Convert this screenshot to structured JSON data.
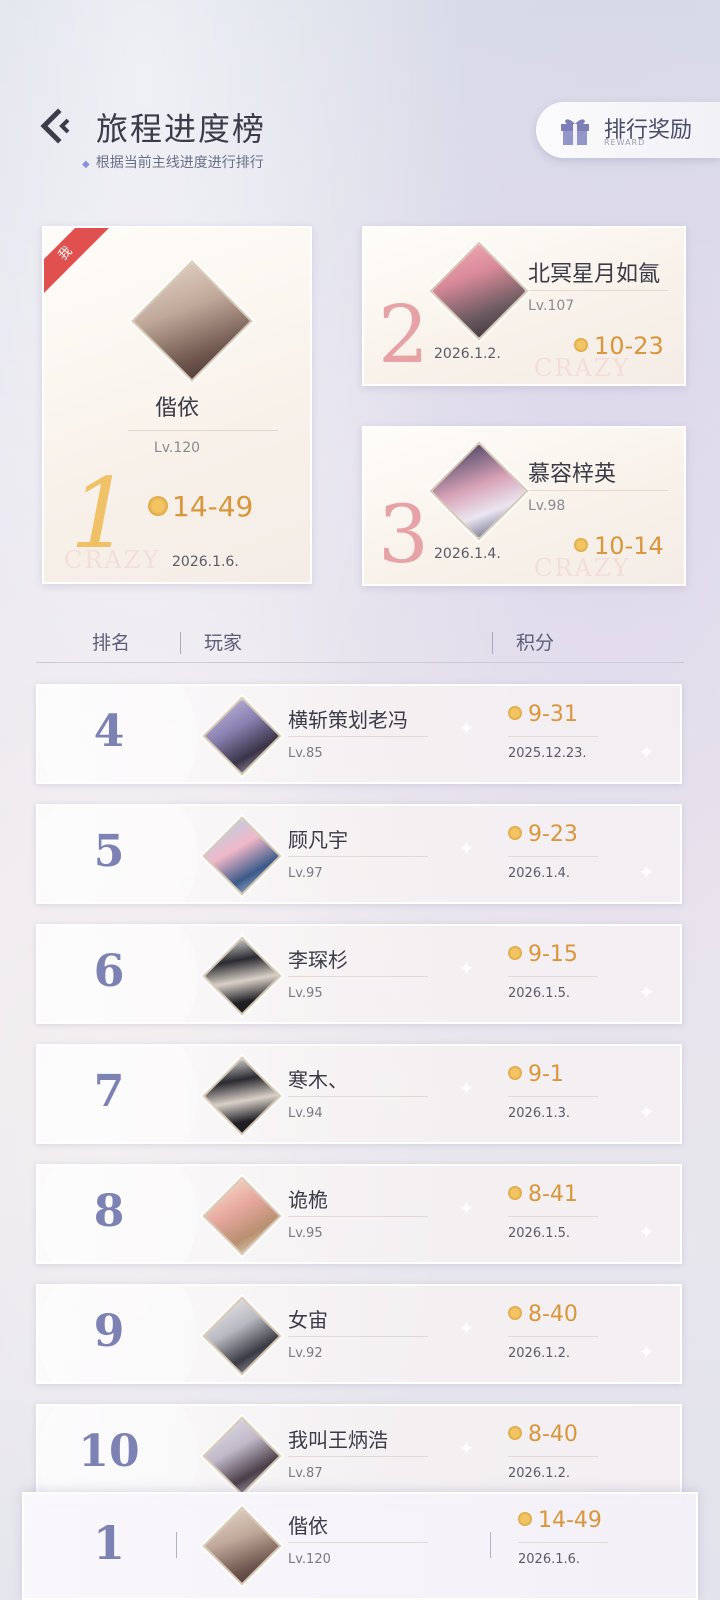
{
  "header": {
    "title": "旅程进度榜",
    "subtitle": "根据当前主线进度进行排行",
    "reward_label": "排行奖励",
    "reward_sub": "REWARD"
  },
  "top3": [
    {
      "rank": "1",
      "name": "偕依",
      "level": "Lv.120",
      "score": "14-49",
      "date": "2026.1.6.",
      "me_tag": "我",
      "avatar": "silver-hair-girl-avatar"
    },
    {
      "rank": "2",
      "name": "北冥星月如氤",
      "level": "Lv.107",
      "score": "10-23",
      "date": "2026.1.2.",
      "avatar": "pink-hair-girl-avatar"
    },
    {
      "rank": "3",
      "name": "慕容梓英",
      "level": "Lv.98",
      "score": "10-14",
      "date": "2026.1.4.",
      "avatar": "pink-hair-night-avatar"
    }
  ],
  "watermark": "CRAZY",
  "columns": {
    "rank": "排名",
    "player": "玩家",
    "score": "积分"
  },
  "rows": [
    {
      "rank": "4",
      "name": "横斩策划老冯",
      "level": "Lv.85",
      "score": "9-31",
      "date": "2025.12.23."
    },
    {
      "rank": "5",
      "name": "顾凡宇",
      "level": "Lv.97",
      "score": "9-23",
      "date": "2026.1.4."
    },
    {
      "rank": "6",
      "name": "李琛杉",
      "level": "Lv.95",
      "score": "9-15",
      "date": "2026.1.5."
    },
    {
      "rank": "7",
      "name": "寒木、",
      "level": "Lv.94",
      "score": "9-1",
      "date": "2026.1.3."
    },
    {
      "rank": "8",
      "name": "诡桅",
      "level": "Lv.95",
      "score": "8-41",
      "date": "2026.1.5."
    },
    {
      "rank": "9",
      "name": "女宙",
      "level": "Lv.92",
      "score": "8-40",
      "date": "2026.1.2."
    },
    {
      "rank": "10",
      "name": "我叫王炳浩",
      "level": "Lv.87",
      "score": "8-40",
      "date": "2026.1.2."
    }
  ],
  "me": {
    "rank": "1",
    "name": "偕依",
    "level": "Lv.120",
    "score": "14-49",
    "date": "2026.1.6."
  },
  "colors": {
    "accent_gold": "#d9963a",
    "rank_purple": "#7d82b4",
    "me_red": "#e0504e"
  },
  "icons": {
    "back": "back-arrow-icon",
    "gift": "gift-icon",
    "coin": "score-coin-icon"
  }
}
